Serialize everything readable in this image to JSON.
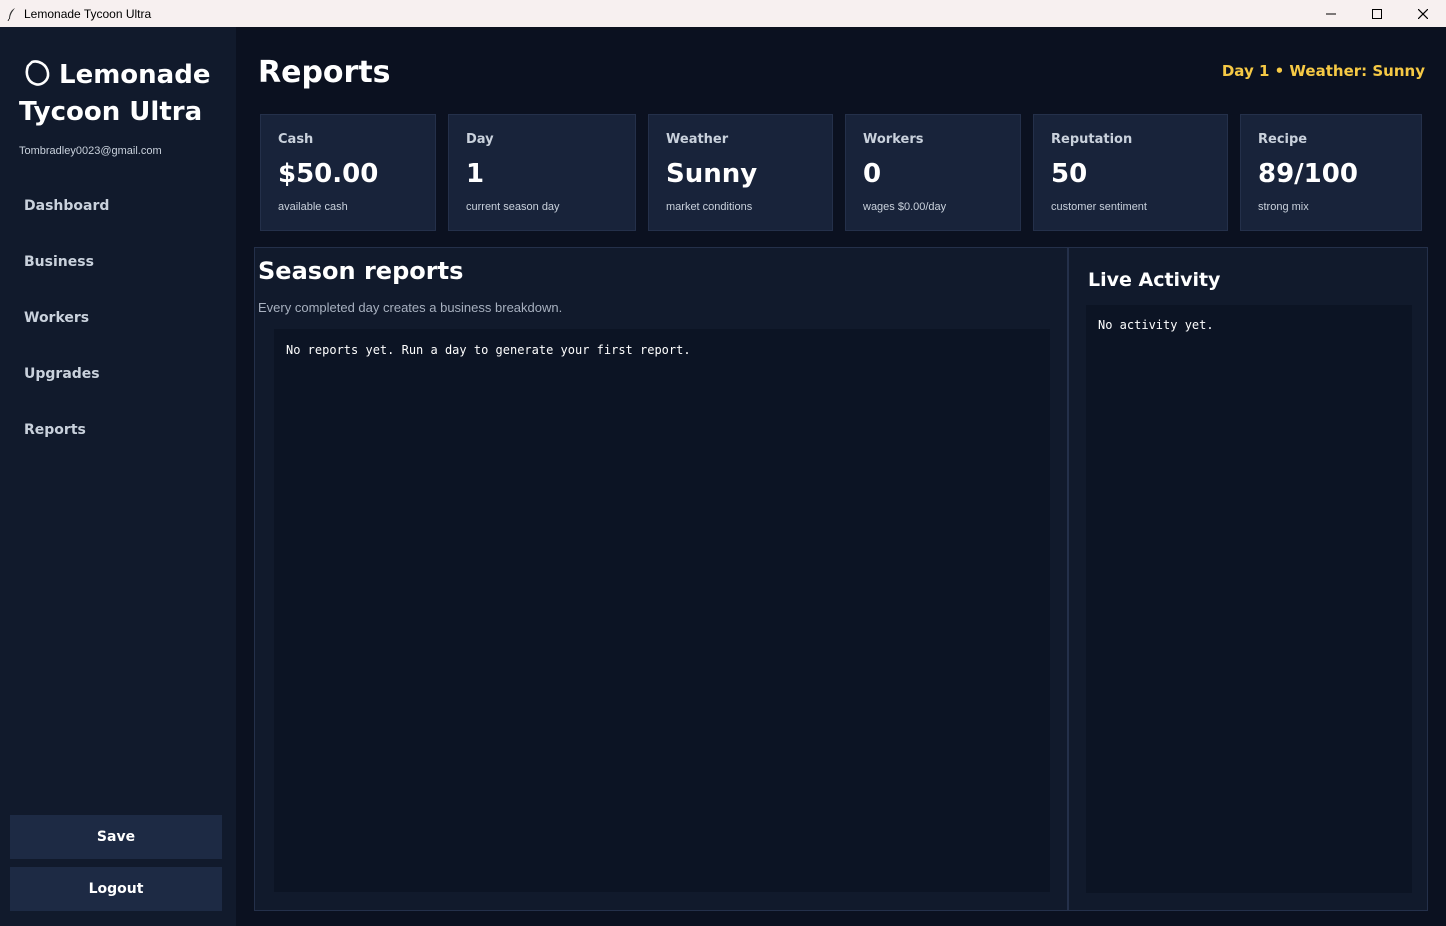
{
  "window": {
    "title": "Lemonade Tycoon Ultra"
  },
  "sidebar": {
    "brand_line1": "Lemonade",
    "brand_line2": "Tycoon Ultra",
    "email": "Tombradley0023@gmail.com",
    "nav": [
      {
        "label": "Dashboard"
      },
      {
        "label": "Business"
      },
      {
        "label": "Workers"
      },
      {
        "label": "Upgrades"
      },
      {
        "label": "Reports"
      }
    ],
    "save_label": "Save",
    "logout_label": "Logout"
  },
  "header": {
    "title": "Reports",
    "status": "Day 1 • Weather: Sunny"
  },
  "cards": [
    {
      "label": "Cash",
      "value": "$50.00",
      "sub": "available cash"
    },
    {
      "label": "Day",
      "value": "1",
      "sub": "current season day"
    },
    {
      "label": "Weather",
      "value": "Sunny",
      "sub": "market conditions"
    },
    {
      "label": "Workers",
      "value": "0",
      "sub": "wages $0.00/day"
    },
    {
      "label": "Reputation",
      "value": "50",
      "sub": "customer sentiment"
    },
    {
      "label": "Recipe",
      "value": "89/100",
      "sub": "strong mix"
    }
  ],
  "reports": {
    "title": "Season reports",
    "description": "Every completed day creates a business breakdown.",
    "content": "No reports yet. Run a day to generate your first report."
  },
  "activity": {
    "title": "Live Activity",
    "content": "No activity yet."
  },
  "colors": {
    "accent": "#f6c945",
    "background": "#0b1120",
    "sidebar": "#111a2c",
    "card": "#18233a",
    "button": "#1d2a44"
  }
}
